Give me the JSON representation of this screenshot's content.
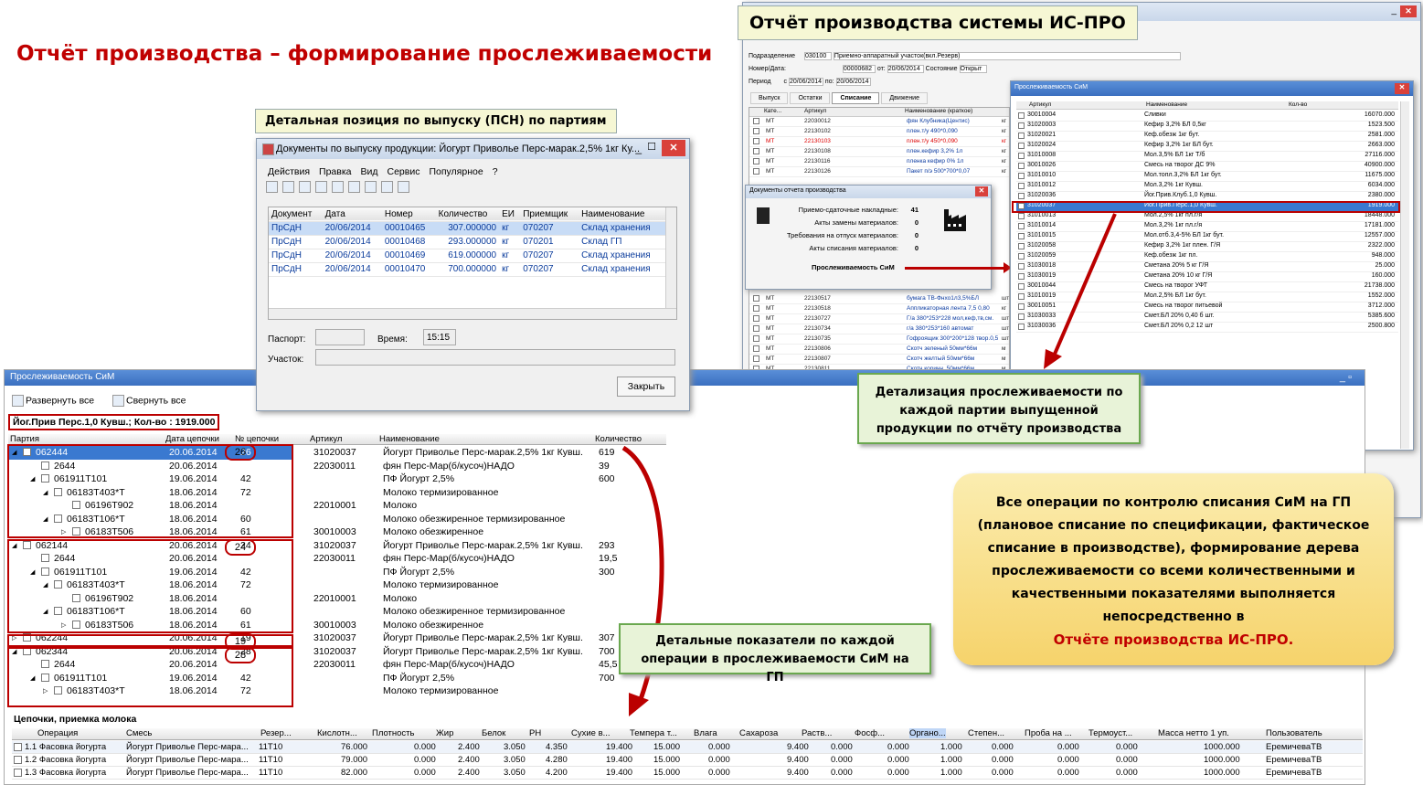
{
  "main_title": "Отчёт производства – формирование прослеживаемости",
  "callout_ispro": "Отчёт производства системы ИС-ПРО",
  "callout_detail": "Детальная позиция по выпуску (ПСН) по партиям",
  "doc_window": {
    "title": "Документы по выпуску продукции: Йогурт Приволье Перс-марак.2,5% 1кг Ку...",
    "menu": [
      "Действия",
      "Правка",
      "Вид",
      "Сервис",
      "Популярное",
      "?"
    ],
    "columns": [
      "Документ",
      "Дата",
      "Номер",
      "Количество",
      "ЕИ",
      "Приемщик",
      "Наименование"
    ],
    "rows": [
      [
        "ПрСдН",
        "20/06/2014",
        "00010465",
        "307.000000",
        "кг",
        "070207",
        "Склад хранения"
      ],
      [
        "ПрСдН",
        "20/06/2014",
        "00010468",
        "293.000000",
        "кг",
        "070201",
        "Склад ГП"
      ],
      [
        "ПрСдН",
        "20/06/2014",
        "00010469",
        "619.000000",
        "кг",
        "070207",
        "Склад хранения"
      ],
      [
        "ПрСдН",
        "20/06/2014",
        "00010470",
        "700.000000",
        "кг",
        "070207",
        "Склад хранения"
      ]
    ],
    "passport_label": "Паспорт:",
    "time_label": "Время:",
    "time_value": "15:15",
    "area_label": "Участок:",
    "close_btn": "Закрыть"
  },
  "ispro": {
    "subdiv_label": "Подразделение",
    "subdiv_code": "030100",
    "subdiv_name": "Приемно-аппаратный участок(вкл.Резерв)",
    "num_label": "Номер/Дата:",
    "num_value": "00000682",
    "from_label": "от:",
    "date_value": "20/06/2014",
    "state_label": "Состояние",
    "state_value": "Открыт",
    "period_label": "Период",
    "period_c": "с",
    "period_from": "20/06/2014",
    "period_to_label": "по:",
    "period_to": "20/06/2014",
    "tabs": [
      "Выпуск",
      "Остатки",
      "Списание",
      "Движение"
    ],
    "col_cat": "Кате...",
    "col_art": "Артикул",
    "col_name": "Наименование (краткое)",
    "left_rows": [
      [
        "МТ",
        "22030012",
        "фян Клубника(Центис)",
        "кг"
      ],
      [
        "МТ",
        "22130102",
        "плен.т/у 490*0,090",
        "кг"
      ],
      [
        "МТ",
        "22130103",
        "плен.т/у 450*0,090",
        "кг"
      ],
      [
        "МТ",
        "22130108",
        "плен.кефир 3,2% 1л",
        "кг"
      ],
      [
        "МТ",
        "22130116",
        "пленка кефир 0% 1л",
        "кг"
      ],
      [
        "МТ",
        "22130126",
        "Пакет п/э 500*700*0,07",
        "кг"
      ]
    ],
    "left_rows2": [
      [
        "МТ",
        "22130517",
        "бумага ТВ-Фнхо1л3,5%БЛ",
        "шт"
      ],
      [
        "МТ",
        "22130518",
        "Аппликаторная лента 7,5 0,80",
        "кг"
      ],
      [
        "МТ",
        "22130727",
        "Г/а 380*253*228 мол,кеф,тв,см.",
        "шт"
      ],
      [
        "МТ",
        "22130734",
        "г/а 380*253*160 автомат",
        "шт"
      ],
      [
        "МТ",
        "22130735",
        "Гофроящик 300*200*128 твор.0,5",
        "шт"
      ],
      [
        "МТ",
        "22130806",
        "Скотч зеленый 50мм*66м",
        "м"
      ],
      [
        "МТ",
        "22130807",
        "Скотч желтый 50мм*66м",
        "м"
      ],
      [
        "МТ",
        "22130811",
        "Скотч коричн. 50мм*66м",
        "м"
      ]
    ],
    "popup_title": "Документы отчета производства",
    "popup_items": [
      [
        "Приемо-сдаточные накладные:",
        "41"
      ],
      [
        "Акты замены материалов:",
        "0"
      ],
      [
        "Требования на отпуск материалов:",
        "0"
      ],
      [
        "Акты списания материалов:",
        "0"
      ]
    ],
    "popup_link": "Прослеживаемость СиМ",
    "trace_title": "Прослеживаемость СиМ",
    "trace_cols": [
      "Артикул",
      "Наименование",
      "Кол-во"
    ],
    "trace_rows": [
      [
        "30010004",
        "Сливки",
        "16070.000"
      ],
      [
        "31020003",
        "Кефир 3,2% БЛ 0,5кг",
        "1523.500"
      ],
      [
        "31020021",
        "Кеф.обезж 1кг бут.",
        "2581.000"
      ],
      [
        "31020024",
        "Кефир 3,2% 1кг БЛ бут.",
        "2663.000"
      ],
      [
        "31010008",
        "Мол.3,5% БЛ 1кг Т/б",
        "27116.000"
      ],
      [
        "30010026",
        "Смесь на творог ДС 9%",
        "40900.000"
      ],
      [
        "31010010",
        "Мол.топл.3,2% БЛ 1кг бут.",
        "11675.000"
      ],
      [
        "31010012",
        "Мол.3,2% 1кг Кувш.",
        "6034.000"
      ],
      [
        "31020036",
        "Йог.Прив.Клуб.1,0 Кувш.",
        "2380.000"
      ],
      [
        "31020037",
        "Йог.Прив.Перс.1,0 Кувш.",
        "1919.000"
      ],
      [
        "31010013",
        "Мол.2,5% 1кг пл.г/я",
        "18448.000"
      ],
      [
        "31010014",
        "Мол.3,2% 1кг пл.г/я",
        "17181.000"
      ],
      [
        "31010015",
        "Мол.отб.3,4-5% БЛ 1кг бут.",
        "12557.000"
      ],
      [
        "31020058",
        "Кефир 3,2% 1кг плен. Г/Я",
        "2322.000"
      ],
      [
        "31020059",
        "Кеф.обезж 1кг пл.",
        "948.000"
      ],
      [
        "31030018",
        "Сметана 20% 5 кг Г/Я",
        "25.000"
      ],
      [
        "31030019",
        "Сметана 20% 10 кг Г/Я",
        "160.000"
      ],
      [
        "30010044",
        "Смесь на творог УФТ",
        "21738.000"
      ],
      [
        "31010019",
        "Мол.2,5% БЛ 1кг бут.",
        "1552.000"
      ],
      [
        "30010051",
        "Смесь на творог питьевой",
        "3712.000"
      ],
      [
        "31030033",
        "Смет.БЛ 20% 0,40 б шт.",
        "5385.600"
      ],
      [
        "31030036",
        "Смет.БЛ 20% 0,2 12 шт",
        "2500.800"
      ]
    ]
  },
  "detail_callout": "Детализация прослеживаемости по каждой партии выпущенной продукции по отчёту производства",
  "ops_callout": "Детальные показатели по каждой операции в прослеживаемости СиМ на ГП",
  "big_callout_text": "Все операции по контролю списания СиМ на ГП (плановое списание по спецификации, фактическое списание в производстве), формирование дерева прослеживаемости со всеми количественными и качественными показателями выполняется непосредственно в",
  "big_callout_red": "Отчёте производства ИС-ПРО.",
  "trace_window": {
    "title": "Прослеживаемость СиМ",
    "expand": "Развернуть все",
    "collapse": "Свернуть все",
    "header_info": "Йог.Прив Перс.1,0 Кувш.; Кол-во : 1919.000",
    "cols": [
      "Партия",
      "Дата цепочки",
      "№ цепочки",
      "Артикул",
      "Наименование",
      "Количество"
    ],
    "rows": [
      {
        "lvl": 0,
        "p": "062444",
        "d": "20.06.2014",
        "n": "26",
        "a": "31020037",
        "name": "Йогурт Приволье Перс-марак.2,5% 1кг Кувш.",
        "q": "619",
        "sel": true
      },
      {
        "lvl": 1,
        "p": "2644",
        "d": "20.06.2014",
        "n": "",
        "a": "22030011",
        "name": "фян Перс-Мар(б/кусоч)НАДО",
        "q": "39"
      },
      {
        "lvl": 1,
        "p": "061911T101",
        "d": "19.06.2014",
        "n": "42",
        "a": "",
        "name": "ПФ Йогурт 2,5%",
        "q": "600"
      },
      {
        "lvl": 2,
        "p": "06183T403*T",
        "d": "18.06.2014",
        "n": "72",
        "a": "",
        "name": "Молоко термизированное",
        "q": ""
      },
      {
        "lvl": 3,
        "p": "06196T902",
        "d": "18.06.2014",
        "n": "",
        "a": "22010001",
        "name": "Молоко",
        "q": ""
      },
      {
        "lvl": 2,
        "p": "06183T106*T",
        "d": "18.06.2014",
        "n": "60",
        "a": "",
        "name": "Молоко обезжиренное термизированное",
        "q": ""
      },
      {
        "lvl": 3,
        "p": "06183T506",
        "d": "18.06.2014",
        "n": "61",
        "a": "30010003",
        "name": "Молоко обезжиренное",
        "q": ""
      },
      {
        "lvl": 0,
        "p": "062144",
        "d": "20.06.2014",
        "n": "24",
        "a": "31020037",
        "name": "Йогурт Приволье Перс-марак.2,5% 1кг Кувш.",
        "q": "293"
      },
      {
        "lvl": 1,
        "p": "2644",
        "d": "20.06.2014",
        "n": "",
        "a": "22030011",
        "name": "фян Перс-Мар(б/кусоч)НАДО",
        "q": "19,5"
      },
      {
        "lvl": 1,
        "p": "061911T101",
        "d": "19.06.2014",
        "n": "42",
        "a": "",
        "name": "ПФ Йогурт 2,5%",
        "q": "300"
      },
      {
        "lvl": 2,
        "p": "06183T403*T",
        "d": "18.06.2014",
        "n": "72",
        "a": "",
        "name": "Молоко термизированное",
        "q": ""
      },
      {
        "lvl": 3,
        "p": "06196T902",
        "d": "18.06.2014",
        "n": "",
        "a": "22010001",
        "name": "Молоко",
        "q": ""
      },
      {
        "lvl": 2,
        "p": "06183T106*T",
        "d": "18.06.2014",
        "n": "60",
        "a": "",
        "name": "Молоко обезжиренное термизированное",
        "q": ""
      },
      {
        "lvl": 3,
        "p": "06183T506",
        "d": "18.06.2014",
        "n": "61",
        "a": "30010003",
        "name": "Молоко обезжиренное",
        "q": ""
      },
      {
        "lvl": 0,
        "p": "062244",
        "d": "20.06.2014",
        "n": "19",
        "a": "31020037",
        "name": "Йогурт Приволье Перс-марак.2,5% 1кг Кувш.",
        "q": "307"
      },
      {
        "lvl": 0,
        "p": "062344",
        "d": "20.06.2014",
        "n": "28",
        "a": "31020037",
        "name": "Йогурт Приволье Перс-марак.2,5% 1кг Кувш.",
        "q": "700"
      },
      {
        "lvl": 1,
        "p": "2644",
        "d": "20.06.2014",
        "n": "",
        "a": "22030011",
        "name": "фян Перс-Мар(б/кусоч)НАДО",
        "q": "45,5"
      },
      {
        "lvl": 1,
        "p": "061911T101",
        "d": "19.06.2014",
        "n": "42",
        "a": "",
        "name": "ПФ Йогурт 2,5%",
        "q": "700"
      },
      {
        "lvl": 2,
        "p": "06183T403*T",
        "d": "18.06.2014",
        "n": "72",
        "a": "",
        "name": "Молоко термизированное",
        "q": ""
      }
    ],
    "chain_title": "Цепочки, приемка молока",
    "op_cols": [
      "Операция",
      "Смесь",
      "Резер...",
      "Кислотн...",
      "Плотность",
      "Жир",
      "Белок",
      "PH",
      "Сухие в...",
      "Темпера т...",
      "Влага",
      "Сахароза",
      "Раств...",
      "Фосф...",
      "Органо...",
      "Степен...",
      "Проба на ...",
      "Термоуст...",
      "Масса нетто 1 уп.",
      "Пользователь"
    ],
    "op_rows": [
      [
        "1.1 Фасовка йогурта",
        "Йогурт Приволье Перс-мара...",
        "11T10",
        "76.000",
        "0.000",
        "2.400",
        "3.050",
        "4.350",
        "19.400",
        "15.000",
        "0.000",
        "9.400",
        "0.000",
        "0.000",
        "1.000",
        "0.000",
        "0.000",
        "0.000",
        "1000.000",
        "ЕремичеваТВ"
      ],
      [
        "1.2 Фасовка йогурта",
        "Йогурт Приволье Перс-мара...",
        "11T10",
        "79.000",
        "0.000",
        "2.400",
        "3.050",
        "4.280",
        "19.400",
        "15.000",
        "0.000",
        "9.400",
        "0.000",
        "0.000",
        "1.000",
        "0.000",
        "0.000",
        "0.000",
        "1000.000",
        "ЕремичеваТВ"
      ],
      [
        "1.3 Фасовка йогурта",
        "Йогурт Приволье Перс-мара...",
        "11T10",
        "82.000",
        "0.000",
        "2.400",
        "3.050",
        "4.200",
        "19.400",
        "15.000",
        "0.000",
        "9.400",
        "0.000",
        "0.000",
        "1.000",
        "0.000",
        "0.000",
        "0.000",
        "1000.000",
        "ЕремичеваТВ"
      ]
    ]
  }
}
